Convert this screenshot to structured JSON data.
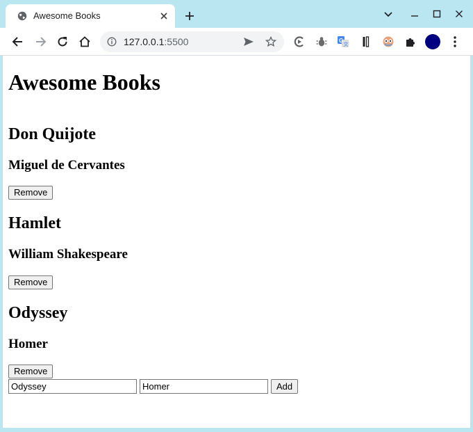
{
  "browser": {
    "tab": {
      "title": "Awesome Books"
    },
    "address": {
      "host": "127.0.0.1",
      "port": ":5500"
    }
  },
  "page": {
    "heading": "Awesome Books",
    "books": [
      {
        "title": "Don Quijote",
        "author": "Miguel de Cervantes",
        "remove_label": "Remove"
      },
      {
        "title": "Hamlet",
        "author": "William Shakespeare",
        "remove_label": "Remove"
      },
      {
        "title": "Odyssey",
        "author": "Homer",
        "remove_label": "Remove"
      }
    ],
    "form": {
      "title_value": "Odyssey",
      "author_value": "Homer",
      "add_label": "Add"
    }
  },
  "icons": {
    "tab": [
      "globe-icon",
      "close-icon",
      "plus-icon"
    ],
    "window": [
      "chevron-down-icon",
      "minimize-icon",
      "maximize-icon",
      "close-icon"
    ],
    "toolbar": [
      "back-arrow-icon",
      "forward-arrow-icon",
      "reload-icon",
      "home-icon",
      "info-icon",
      "send-icon",
      "star-icon"
    ],
    "extensions": [
      "extension-c-icon",
      "bug-icon",
      "translate-icon",
      "bookmark-extension-icon",
      "owl-icon",
      "puzzle-icon",
      "profile-avatar",
      "more-vertical-icon"
    ]
  },
  "colors": {
    "frame": "#b9e6f1",
    "profile": "#000080",
    "page_bg": "#ffffff"
  }
}
